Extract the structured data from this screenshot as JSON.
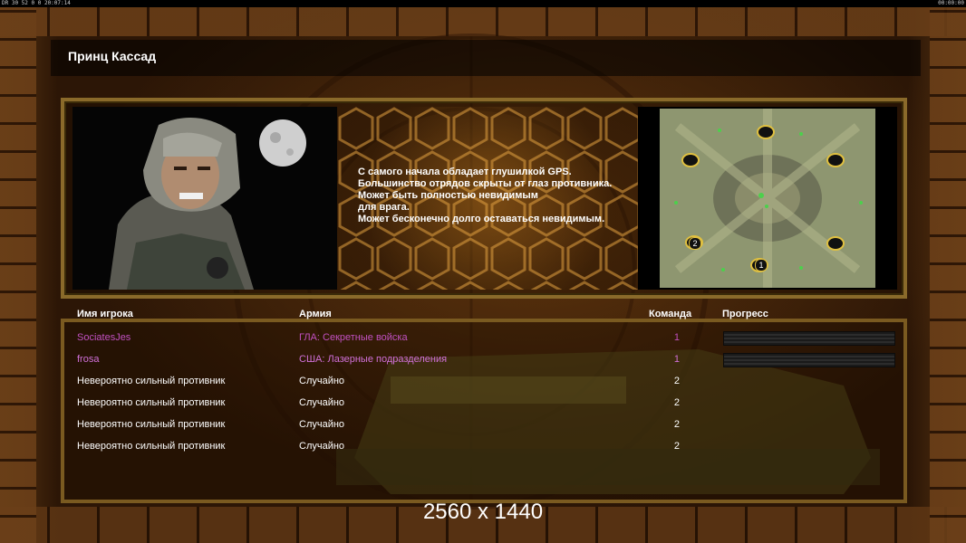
{
  "statusbar": {
    "left": "DR 30 52 0 0 20:07:14",
    "right": "00:00:00"
  },
  "title": "Принц Кассад",
  "description": "С самого начала обладает глушилкой GPS.\nБольшинство отрядов скрыты от глаз противника.\nМожет быть полностью невидимым\nдля врага.\nМожет бесконечно долго оставаться невидимым.",
  "table": {
    "headers": {
      "name": "Имя игрока",
      "army": "Армия",
      "team": "Команда",
      "progress": "Прогресс"
    },
    "rows": [
      {
        "name": "SociatesJes",
        "army": "ГЛА: Секретные войска",
        "team": "1",
        "color": "#c050c0",
        "has_progress": true
      },
      {
        "name": "frosa",
        "army": "США: Лазерные подразделения",
        "team": "1",
        "color": "#d070d8",
        "has_progress": true
      },
      {
        "name": "Невероятно сильный противник",
        "army": "Случайно",
        "team": "2",
        "color": "#ffffff",
        "has_progress": false
      },
      {
        "name": "Невероятно сильный противник",
        "army": "Случайно",
        "team": "2",
        "color": "#ffffff",
        "has_progress": false
      },
      {
        "name": "Невероятно сильный противник",
        "army": "Случайно",
        "team": "2",
        "color": "#ffffff",
        "has_progress": false
      },
      {
        "name": "Невероятно сильный противник",
        "army": "Случайно",
        "team": "2",
        "color": "#ffffff",
        "has_progress": false
      }
    ]
  },
  "minimap": {
    "start_markers": [
      "1",
      "2"
    ]
  },
  "watermark": "2560 x 1440"
}
